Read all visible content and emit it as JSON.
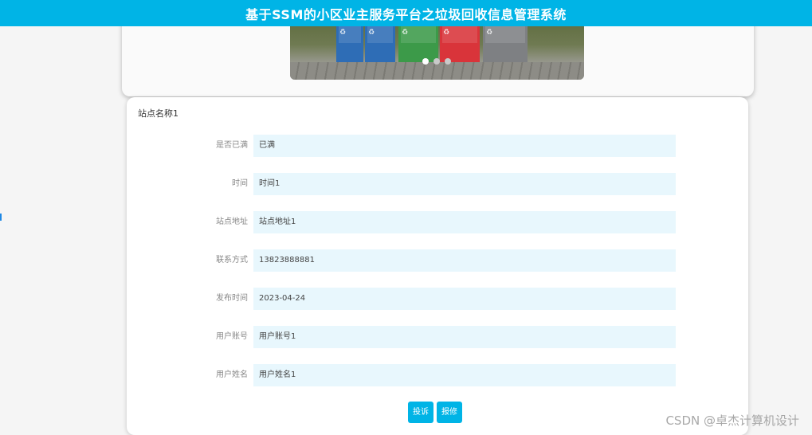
{
  "header": {
    "title": "基于SSM的小区业主服务平台之垃圾回收信息管理系统"
  },
  "banner": {
    "bin_colors": [
      "#2e6db6",
      "#2e6db6",
      "#3c9a49",
      "#d9343a",
      "#7e8083"
    ]
  },
  "detail": {
    "title": "站点名称1",
    "fields": [
      {
        "label": "是否已满",
        "value": "已满"
      },
      {
        "label": "时间",
        "value": "时间1"
      },
      {
        "label": "站点地址",
        "value": "站点地址1"
      },
      {
        "label": "联系方式",
        "value": "13823888881"
      },
      {
        "label": "发布时间",
        "value": "2023-04-24"
      },
      {
        "label": "用户账号",
        "value": "用户账号1"
      },
      {
        "label": "用户姓名",
        "value": "用户姓名1"
      }
    ],
    "buttons": {
      "complain": "投诉",
      "report": "报修"
    }
  },
  "watermark": "CSDN @卓杰计算机设计"
}
